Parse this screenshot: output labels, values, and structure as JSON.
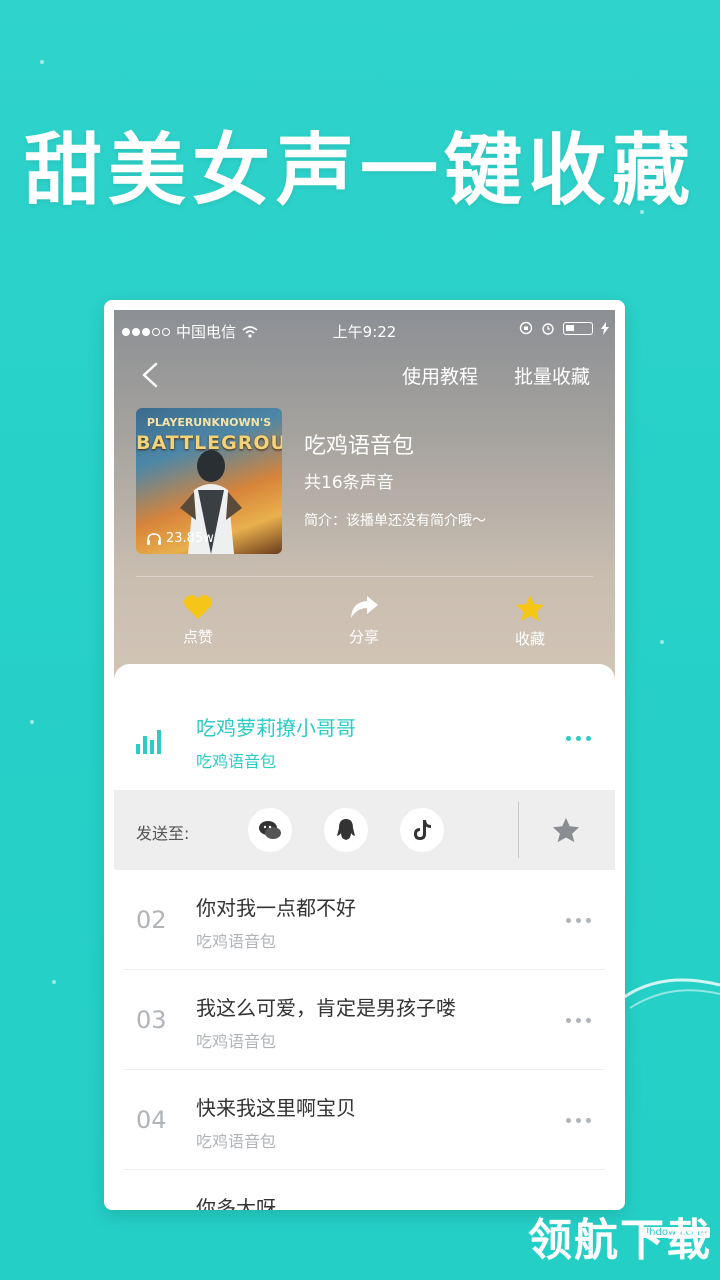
{
  "promo": {
    "headline": "甜美女声一键收藏",
    "brand": "领航下载",
    "brand_url": "lhdown.com"
  },
  "statusbar": {
    "carrier": "中国电信",
    "time": "上午9:22"
  },
  "nav": {
    "tutorial": "使用教程",
    "batch_collect": "批量收藏"
  },
  "playlist": {
    "cover_line1": "PLAYERUNKNOWN'S",
    "cover_line2": "BATTLEGROUNDS",
    "play_count": "23.85w",
    "title": "吃鸡语音包",
    "count": "共16条声音",
    "description": "简介：该播单还没有简介哦～"
  },
  "actions": {
    "like": "点赞",
    "share": "分享",
    "collect": "收藏"
  },
  "now_playing": {
    "title": "吃鸡萝莉撩小哥哥",
    "subtitle": "吃鸡语音包"
  },
  "share_bar": {
    "label": "发送至:"
  },
  "tracks": [
    {
      "num": "02",
      "title": "你对我一点都不好",
      "sub": "吃鸡语音包"
    },
    {
      "num": "03",
      "title": "我这么可爱，肯定是男孩子喽",
      "sub": "吃鸡语音包"
    },
    {
      "num": "04",
      "title": "快来我这里啊宝贝",
      "sub": "吃鸡语音包"
    },
    {
      "num": "",
      "title": "你多大呀",
      "sub": ""
    }
  ],
  "colors": {
    "accent": "#2ccbc3",
    "background": "#27d1c8",
    "like": "#f5c518",
    "collect": "#f5c518"
  }
}
